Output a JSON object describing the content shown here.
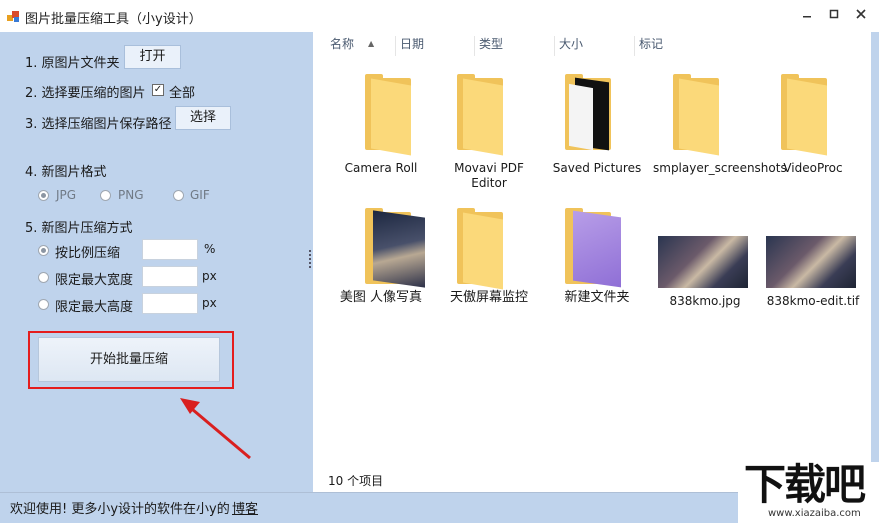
{
  "window": {
    "title": "图片批量压缩工具（小y设计）",
    "controls": [
      "minimize-icon",
      "restore-icon",
      "close-icon"
    ]
  },
  "left_panel": {
    "step1": {
      "label": "1. 原图片文件夹",
      "button": "打开"
    },
    "step2": {
      "label": "2. 选择要压缩的图片",
      "checkbox_label": "全部",
      "checked": true
    },
    "step3": {
      "label": "3. 选择压缩图片保存路径",
      "button": "选择"
    },
    "step4": {
      "label": "4. 新图片格式",
      "options": [
        {
          "label": "JPG",
          "selected": true
        },
        {
          "label": "PNG",
          "selected": false
        },
        {
          "label": "GIF",
          "selected": false
        }
      ]
    },
    "step5": {
      "label": "5. 新图片压缩方式",
      "options": [
        {
          "label": "按比例压缩",
          "selected": true,
          "value": "",
          "unit": "%"
        },
        {
          "label": "限定最大宽度",
          "selected": false,
          "value": "",
          "unit": "px"
        },
        {
          "label": "限定最大高度",
          "selected": false,
          "value": "",
          "unit": "px"
        }
      ]
    },
    "start_button": "开始批量压缩"
  },
  "explorer": {
    "columns": [
      "名称",
      "日期",
      "类型",
      "大小",
      "标记"
    ],
    "items": [
      {
        "name": "Camera Roll",
        "kind": "folder"
      },
      {
        "name": "Movavi PDF Editor",
        "kind": "folder"
      },
      {
        "name": "Saved Pictures",
        "kind": "folder"
      },
      {
        "name": "smplayer_screenshots",
        "kind": "folder"
      },
      {
        "name": "VideoProc",
        "kind": "folder"
      },
      {
        "name": "美图 人像写真",
        "kind": "folder"
      },
      {
        "name": "天傲屏幕监控",
        "kind": "folder"
      },
      {
        "name": "新建文件夹",
        "kind": "folder"
      },
      {
        "name": "838kmo.jpg",
        "kind": "image"
      },
      {
        "name": "838kmo-edit.tif",
        "kind": "image"
      }
    ],
    "item_count": "10 个项目"
  },
  "status_bar": {
    "text": "欢迎使用! 更多小y设计的软件在小y的",
    "link": "博客"
  },
  "watermark": {
    "big": "下载吧",
    "small": "www.xiazaiba.com"
  },
  "colors": {
    "panel_bg": "#bfd3ec",
    "highlight": "#e51d1d",
    "folder": "#f0c35a"
  }
}
